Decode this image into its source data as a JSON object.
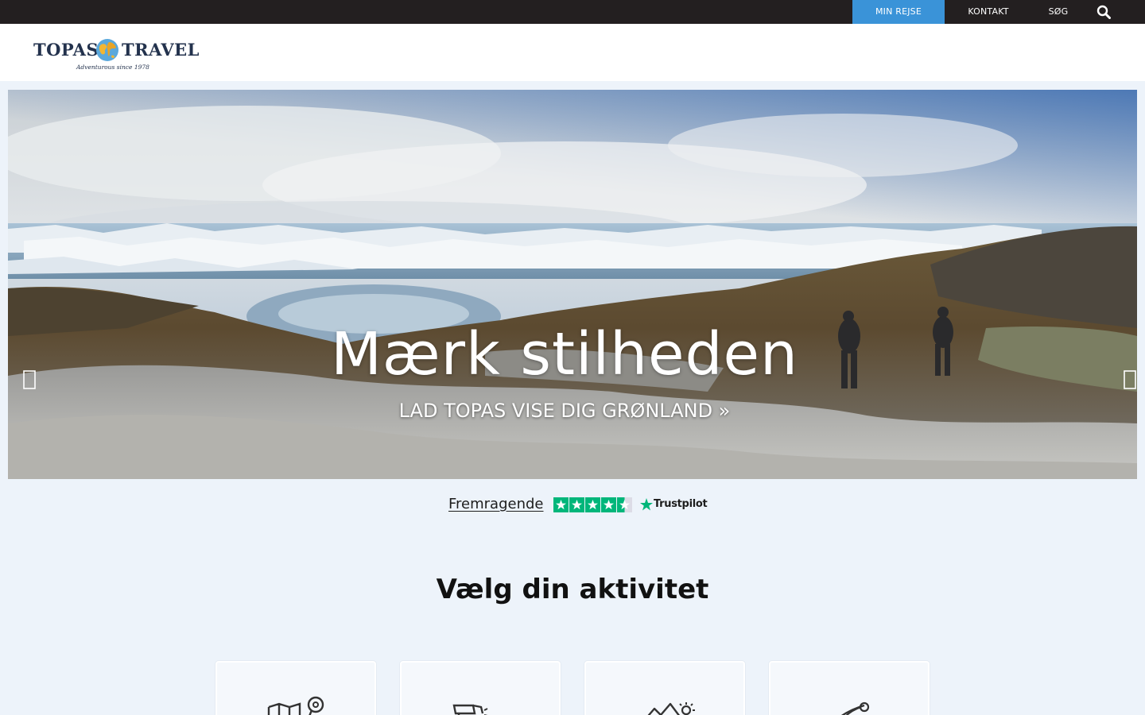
{
  "topbar": {
    "min_rejse": "MIN REJSE",
    "kontakt": "KONTAKT",
    "sog": "SØG",
    "search_icon": "search-icon"
  },
  "header": {
    "logo_word_1": "TOPAS",
    "logo_word_2": "TRAVEL",
    "logo_tagline": "Adventurous since 1978"
  },
  "hero": {
    "title": "Mærk stilheden",
    "link": "LAD TOPAS VISE DIG GRØNLAND »",
    "prev_icon": "chevron-left-icon",
    "next_icon": "chevron-right-icon"
  },
  "trust": {
    "label": "Fremragende",
    "brand": "Trustpilot",
    "stars": 4.5
  },
  "activities": {
    "title": "Vælg din aktivitet",
    "cards": [
      {
        "icon": "map-pin-icon"
      },
      {
        "icon": "bicycle-icon"
      },
      {
        "icon": "mountain-sun-icon"
      },
      {
        "icon": "kayak-icon"
      }
    ]
  },
  "colors": {
    "topbar_bg": "#231f20",
    "accent": "#3a93d8",
    "page_bg": "#edf3fa",
    "trustpilot_green": "#00b67a"
  }
}
